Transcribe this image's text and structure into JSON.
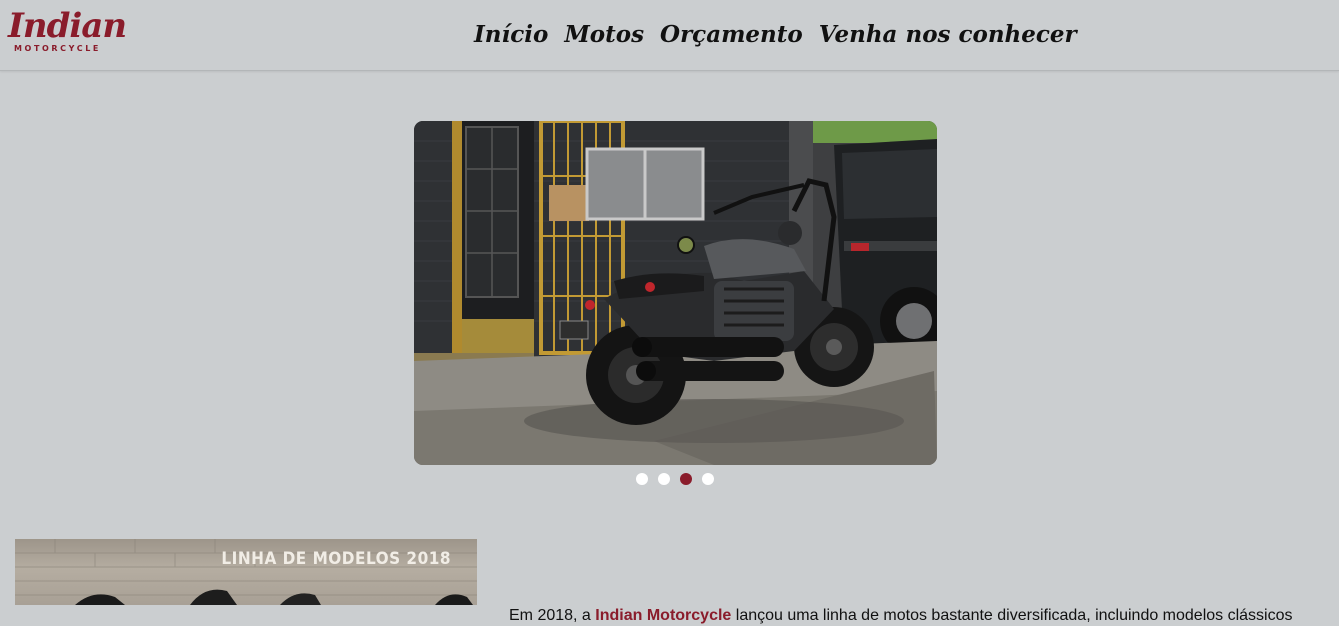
{
  "header": {
    "logo": {
      "script": "Indian",
      "sub": "MOTORCYCLE"
    },
    "nav": [
      {
        "label": "Início"
      },
      {
        "label": "Motos"
      },
      {
        "label": "Orçamento"
      },
      {
        "label": "Venha nos conhecer"
      }
    ]
  },
  "carousel": {
    "slide_count": 4,
    "active_index": 2
  },
  "promo": {
    "title": "LINHA DE MODELOS 2018"
  },
  "intro": {
    "before": "Em 2018, a ",
    "brand": "Indian Motorcycle",
    "after": " lançou uma linha de motos bastante diversificada, incluindo modelos clássicos"
  },
  "colors": {
    "background": "#cbced0",
    "accent": "#8a1c2b"
  }
}
